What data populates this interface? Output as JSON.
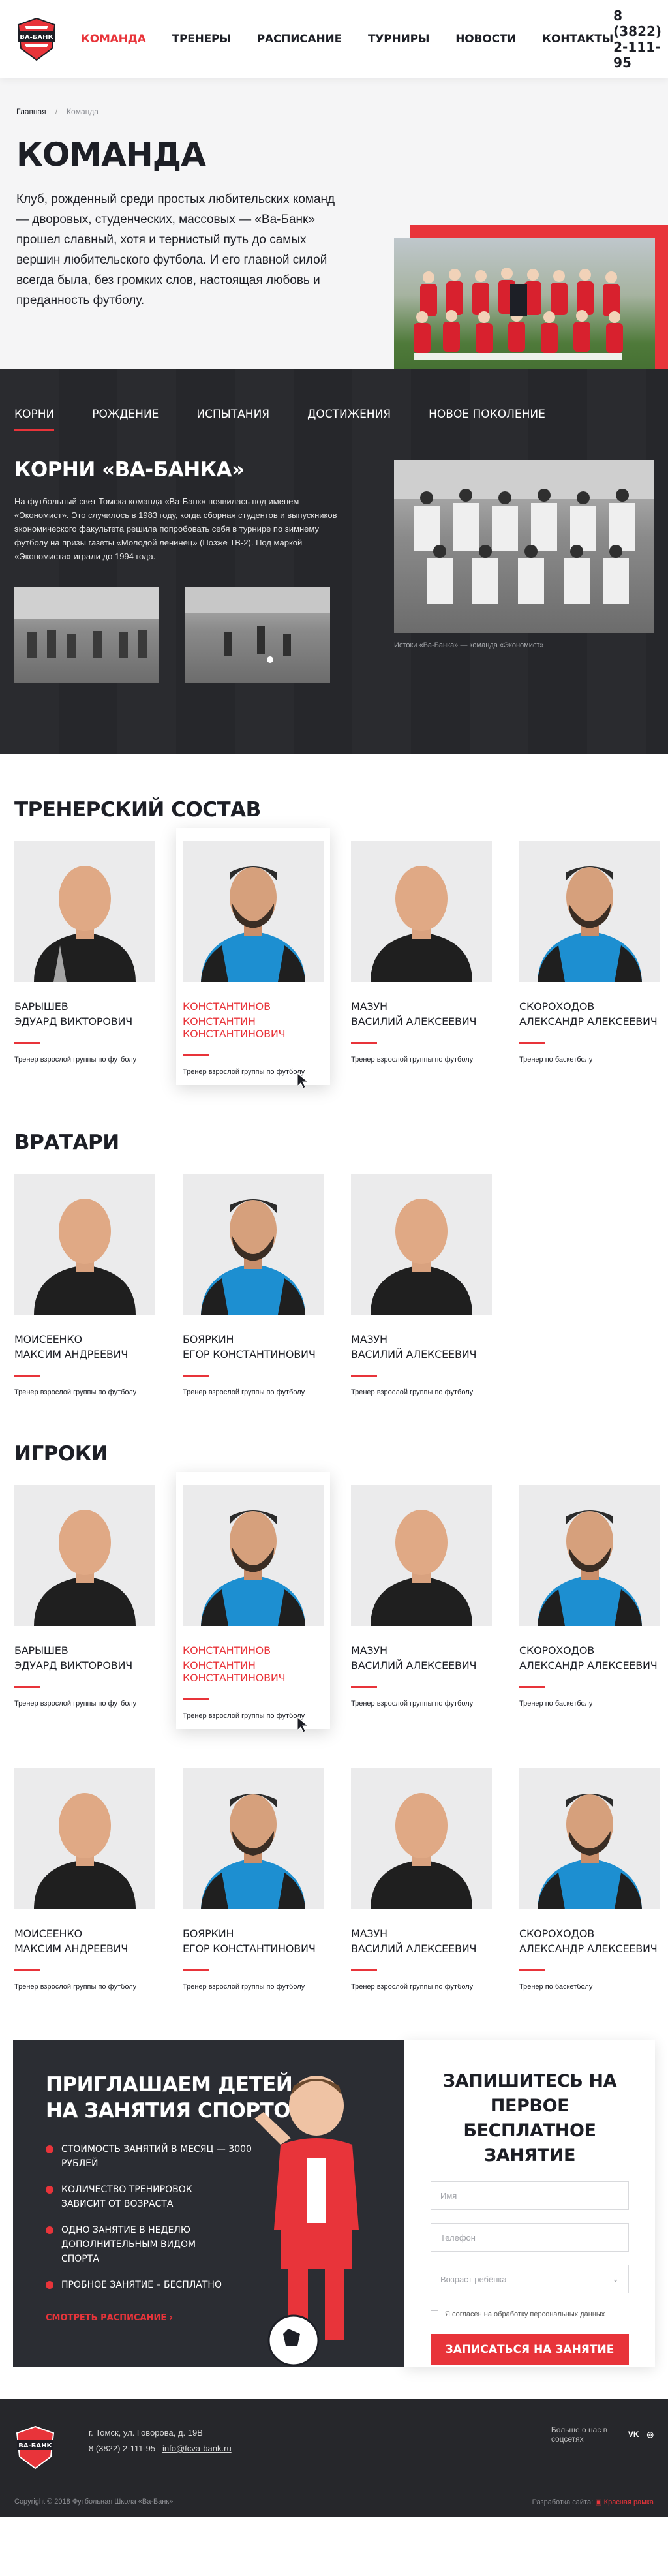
{
  "header": {
    "nav": [
      "КОМАНДА",
      "ТРЕНЕРЫ",
      "РАСПИСАНИЕ",
      "ТУРНИРЫ",
      "НОВОСТИ",
      "КОНТАКТЫ"
    ],
    "phone": "8 (3822) 2-111-95",
    "logo_text": "ВА-БАНК"
  },
  "breadcrumbs": {
    "home": "Главная",
    "current": "Команда"
  },
  "hero": {
    "title": "КОМАНДА",
    "text": "Клуб, рожденный среди простых любительских команд — дворовых, студенческих, массовых — «Ва-Банк» прошел славный, хотя и тернистый путь до самых вершин любительского футбола. И его главной силой всегда была, без громких слов, настоящая любовь и преданность футболу."
  },
  "history": {
    "tabs": [
      "КОРНИ",
      "РОЖДЕНИЕ",
      "ИСПЫТАНИЯ",
      "ДОСТИЖЕНИЯ",
      "НОВОЕ ПОКОЛЕНИЕ"
    ],
    "title": "КОРНИ «ВА-БАНКА»",
    "text": "На футбольный свет Томска команда «Ва-Банк» появилась под именем — «Экономист». Это случилось в 1983 году, когда сборная студентов и выпускников экономического факультета решила попробовать себя в турнире по зимнему футболу на призы газеты «Молодой ленинец» (Позже ТВ-2). Под маркой «Экономиста» играли до 1994 года.",
    "caption": "Истоки «Ва-Банка» — команда «Экономист»"
  },
  "coaches": {
    "title": "ТРЕНЕРСКИЙ СОСТАВ",
    "items": [
      {
        "last": "БАРЫШЕВ",
        "first": "ЭДУАРД ВИКТОРОВИЧ",
        "role": "Тренер взрослой группы по футболу"
      },
      {
        "last": "КОНСТАНТИНОВ",
        "first": "КОНСТАНТИН КОНСТАНТИНОВИЧ",
        "role": "Тренер взрослой группы по футболу"
      },
      {
        "last": "МАЗУН",
        "first": "ВАСИЛИЙ АЛЕКСЕЕВИЧ",
        "role": "Тренер взрослой группы по футболу"
      },
      {
        "last": "СКОРОХОДОВ",
        "first": "АЛЕКСАНДР АЛЕКСЕЕВИЧ",
        "role": "Тренер по баскетболу"
      }
    ]
  },
  "goalkeepers": {
    "title": "ВРАТАРИ",
    "items": [
      {
        "last": "МОИСЕЕНКО",
        "first": "МАКСИМ АНДРЕЕВИЧ",
        "role": "Тренер взрослой группы по футболу"
      },
      {
        "last": "БОЯРКИН",
        "first": "ЕГОР КОНСТАНТИНОВИЧ",
        "role": "Тренер взрослой группы по футболу"
      },
      {
        "last": "МАЗУН",
        "first": "ВАСИЛИЙ АЛЕКСЕЕВИЧ",
        "role": "Тренер взрослой группы по футболу"
      }
    ]
  },
  "players": {
    "title": "ИГРОКИ",
    "row1": [
      {
        "last": "БАРЫШЕВ",
        "first": "ЭДУАРД ВИКТОРОВИЧ",
        "role": "Тренер взрослой группы по футболу"
      },
      {
        "last": "КОНСТАНТИНОВ",
        "first": "КОНСТАНТИН КОНСТАНТИНОВИЧ",
        "role": "Тренер взрослой группы по футболу"
      },
      {
        "last": "МАЗУН",
        "first": "ВАСИЛИЙ АЛЕКСЕЕВИЧ",
        "role": "Тренер взрослой группы по футболу"
      },
      {
        "last": "СКОРОХОДОВ",
        "first": "АЛЕКСАНДР АЛЕКСЕЕВИЧ",
        "role": "Тренер по баскетболу"
      }
    ],
    "row2": [
      {
        "last": "МОИСЕЕНКО",
        "first": "МАКСИМ АНДРЕЕВИЧ",
        "role": "Тренер взрослой группы по футболу"
      },
      {
        "last": "БОЯРКИН",
        "first": "ЕГОР КОНСТАНТИНОВИЧ",
        "role": "Тренер взрослой группы по футболу"
      },
      {
        "last": "МАЗУН",
        "first": "ВАСИЛИЙ АЛЕКСЕЕВИЧ",
        "role": "Тренер взрослой группы по футболу"
      },
      {
        "last": "СКОРОХОДОВ",
        "first": "АЛЕКСАНДР АЛЕКСЕЕВИЧ",
        "role": "Тренер по баскетболу"
      }
    ]
  },
  "cta": {
    "title1": "ПРИГЛАШАЕМ ДЕТЕЙ",
    "title2": "НА ЗАНЯТИЯ СПОРТОМ",
    "items": [
      "СТОИМОСТЬ ЗАНЯТИЙ В МЕСЯЦ — 3000 РУБЛЕЙ",
      "КОЛИЧЕСТВО ТРЕНИРОВОК ЗАВИСИТ ОТ ВОЗРАСТА",
      "ОДНО ЗАНЯТИЕ В НЕДЕЛЮ ДОПОЛНИТЕЛЬНЫМ ВИДОМ СПОРТА",
      "ПРОБНОЕ ЗАНЯТИЕ – БЕСПЛАТНО"
    ],
    "link": "СМОТРЕТЬ РАСПИСАНИЕ ›",
    "form_title": "ЗАПИШИТЕСЬ НА ПЕРВОЕ БЕСПЛАТНОЕ ЗАНЯТИЕ",
    "name_ph": "Имя",
    "phone_ph": "Телефон",
    "age_ph": "Возраст ребёнка",
    "agree": "Я согласен на обработку персональных данных",
    "submit": "ЗАПИСАТЬСЯ НА ЗАНЯТИЕ"
  },
  "footer": {
    "address": "г. Томск, ул. Говорова, д. 19В",
    "phone": "8 (3822) 2-111-95",
    "email": "info@fcva-bank.ru",
    "social_label": "Больше о нас в соцсетях",
    "copyright": "Copyright © 2018 Футбольная Школа «Ва-Банк»",
    "developer_label": "Разработка сайта:",
    "developer": "Красная рамка"
  },
  "colors": {
    "accent": "#e8343a",
    "dark": "#26272b"
  }
}
